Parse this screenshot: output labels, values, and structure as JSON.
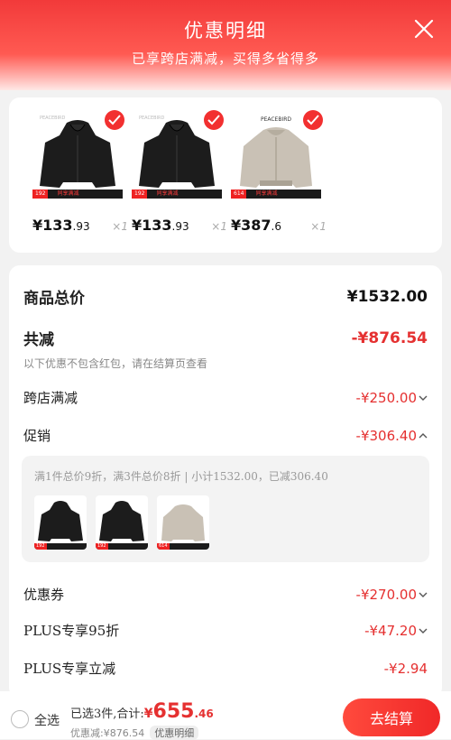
{
  "header": {
    "title": "优惠明细",
    "subtitle": "已享跨店满减，买得多省得多"
  },
  "goods": [
    {
      "price_int": "¥133",
      "price_dec": ".93",
      "qty": "×1",
      "badge": "192",
      "strip_text": "同享满减",
      "brand": "PEACEBIRD"
    },
    {
      "price_int": "¥133",
      "price_dec": ".93",
      "qty": "×1",
      "badge": "192",
      "strip_text": "同享满减",
      "brand": "PEACEBIRD"
    },
    {
      "price_int": "¥387",
      "price_dec": ".6",
      "qty": "×1",
      "badge": "614",
      "strip_text": "同享满减",
      "brand": "PEACEBIRD"
    }
  ],
  "details": {
    "total_label": "商品总价",
    "total_value": "¥1532.00",
    "reduce_label": "共减",
    "reduce_value": "-¥876.54",
    "note": "以下优惠不包含红包，请在结算页查看",
    "cross_store_label": "跨店满减",
    "cross_store_value": "-¥250.00",
    "promo_label": "促销",
    "promo_value": "-¥306.40",
    "promo_desc": "满1件总价9折，满3件总价8折 | 小计1532.00，已减306.40",
    "coupon_label": "优惠券",
    "coupon_value": "-¥270.00",
    "plus95_label": "PLUS专享95折",
    "plus95_value": "-¥47.20",
    "plus_direct_label": "PLUS专享立减",
    "plus_direct_value": "-¥2.94"
  },
  "bottom": {
    "select_all": "全选",
    "summary_label": "已选3件,合计:",
    "total_yen": "¥",
    "total_int": "655",
    "total_dec": ".46",
    "discount_text": "优惠减:¥876.54",
    "detail_tag": "优惠明细",
    "checkout": "去结算"
  },
  "colors": {
    "accent": "#f23030",
    "header_top": "#f23a3a",
    "text_red": "#e53030"
  }
}
